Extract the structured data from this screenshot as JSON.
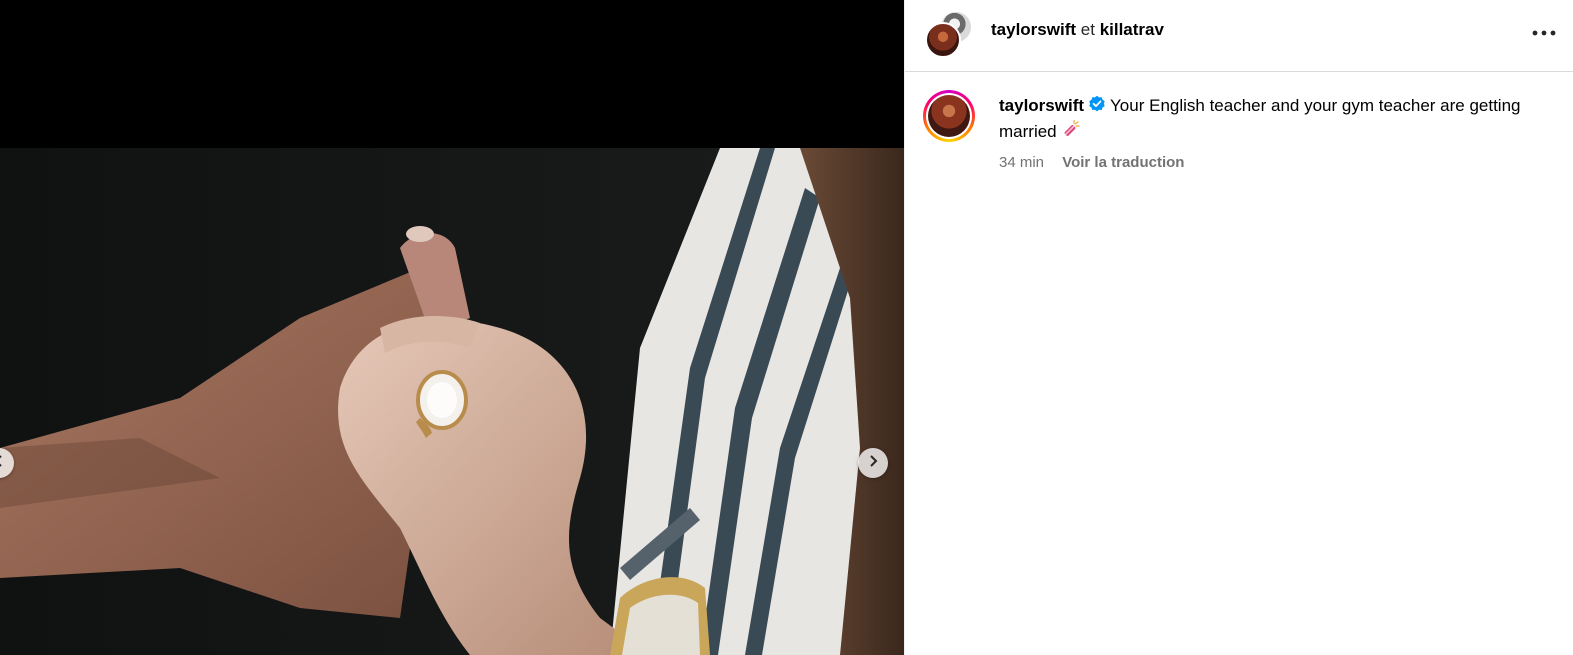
{
  "header": {
    "user1": "taylorswift",
    "joiner": "et",
    "user2": "killatrav",
    "more_icon": "more-horizontal-icon"
  },
  "caption": {
    "username": "taylorswift",
    "verified_icon": "verified-badge-icon",
    "text": "Your English teacher and your gym teacher are getting married",
    "emoji_icon": "firecracker-emoji-icon",
    "timestamp": "34 min",
    "translate_link": "Voir la traduction"
  },
  "media": {
    "next_icon": "chevron-right-icon",
    "prev_icon": "chevron-left-icon"
  },
  "colors": {
    "verified": "#0095f6",
    "meta_text": "#737373",
    "divider": "#dbdbdb"
  }
}
